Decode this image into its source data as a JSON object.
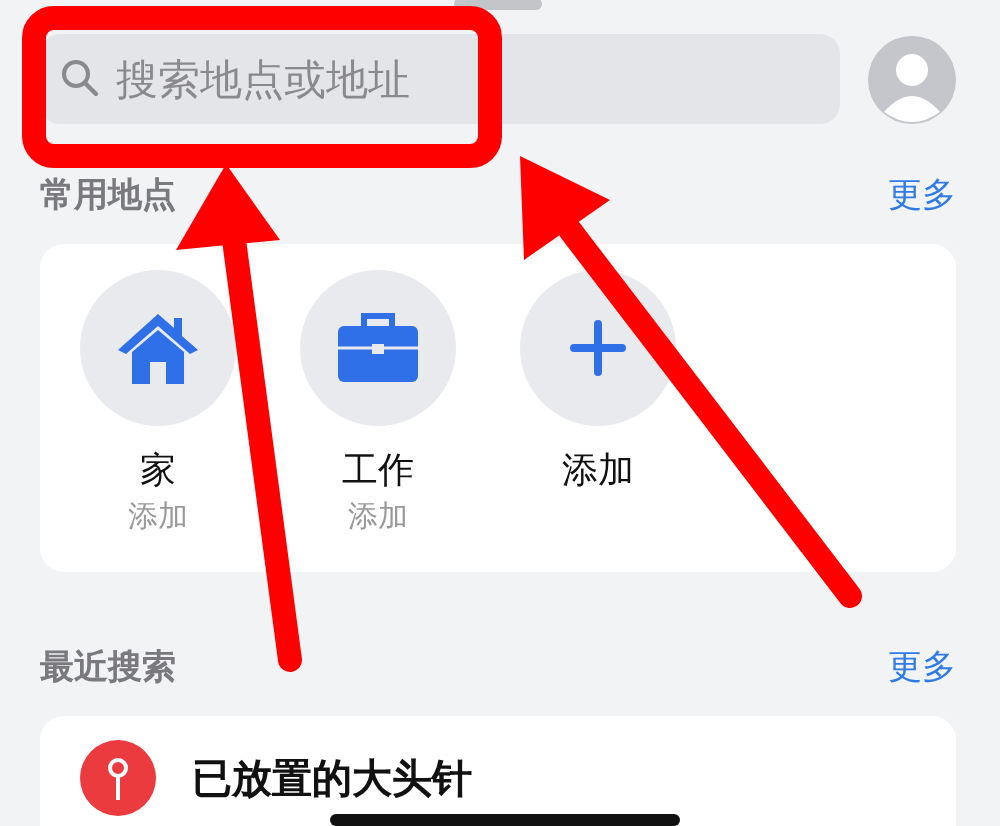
{
  "search": {
    "placeholder": "搜索地点或地址"
  },
  "favorites": {
    "title": "常用地点",
    "more": "更多",
    "items": [
      {
        "kind": "home",
        "label": "家",
        "sublabel": "添加"
      },
      {
        "kind": "work",
        "label": "工作",
        "sublabel": "添加"
      },
      {
        "kind": "add",
        "label": "添加"
      }
    ]
  },
  "recents": {
    "title": "最近搜索",
    "more": "更多",
    "items": [
      {
        "kind": "pin",
        "title": "已放置的大头针"
      }
    ]
  }
}
